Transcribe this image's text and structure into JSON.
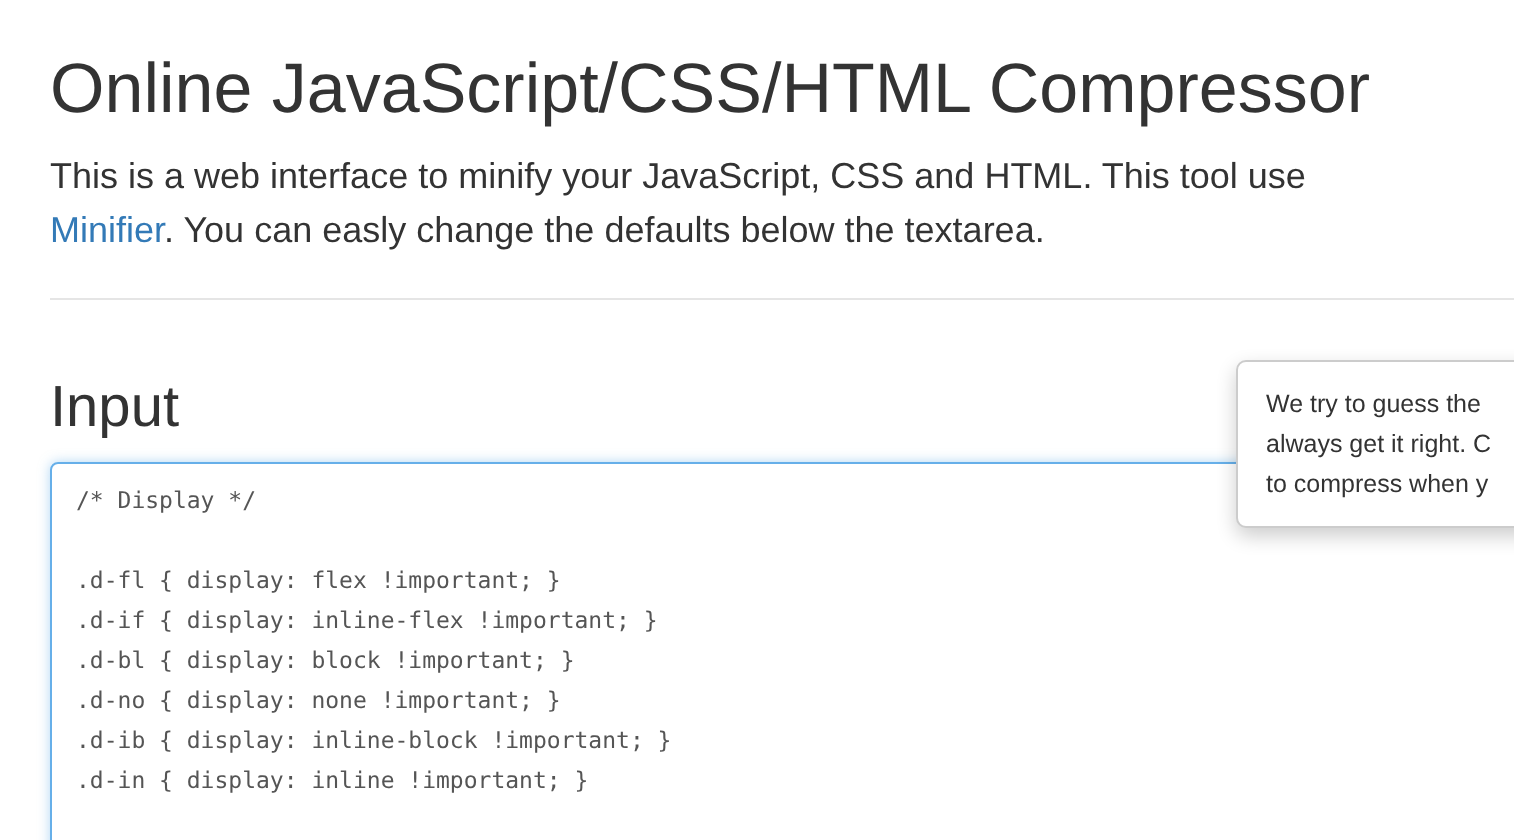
{
  "page": {
    "title": "Online JavaScript/CSS/HTML Compressor"
  },
  "intro": {
    "line_1": "This is a web interface to minify your JavaScript, CSS and HTML. This tool use",
    "link": "Minifier",
    "line_2_rest": ". You can easly change the defaults below the textarea."
  },
  "input_section": {
    "heading": "Input",
    "value": "/* Display */\n\n.d-fl { display: flex !important; }\n.d-if { display: inline-flex !important; }\n.d-bl { display: block !important; }\n.d-no { display: none !important; }\n.d-ib { display: inline-block !important; }\n.d-in { display: inline !important; }"
  },
  "tooltip": {
    "lines": [
      "We try to guess the",
      "always get it right. C",
      "to compress when y"
    ]
  }
}
